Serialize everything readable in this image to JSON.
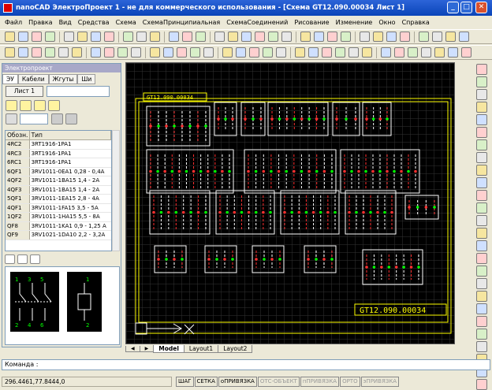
{
  "window": {
    "title": "nanoCAD ЭлектроПроект 1 - не для коммерческого использования - [Схема GT12.090.00034 Лист 1]"
  },
  "menu": [
    "Файл",
    "Правка",
    "Вид",
    "Средства",
    "Схема",
    "СхемаПринципиальная",
    "СхемаСоединений",
    "Рисование",
    "Изменение",
    "Окно",
    "Справка"
  ],
  "panel": {
    "title": "Электропроект",
    "tabs": [
      "ЭУ",
      "Кабели",
      "Жгуты",
      "Ши"
    ],
    "sheet_button": "Лист 1",
    "columns": [
      "Обозн.",
      "Тип"
    ],
    "rows": [
      [
        "4RC2",
        "3RT1916-1PA1"
      ],
      [
        "4RC3",
        "3RT1916-1PA1"
      ],
      [
        "6RC1",
        "3RT1916-1PA1"
      ],
      [
        "6QF1",
        "3RV1011-0EA1 0,28 - 0,4A"
      ],
      [
        "4QF2",
        "3RV1011-1BA15 1,4 - 2A"
      ],
      [
        "4QF3",
        "3RV1011-1BA15 1,4 - 2A"
      ],
      [
        "5QF1",
        "3RV1011-1EA15 2,8 - 4A"
      ],
      [
        "4QF1",
        "3RV1011-1FA15 3,5 - 5A"
      ],
      [
        "1QF2",
        "3RV1011-1HA15 5,5 - 8A"
      ],
      [
        "QF8",
        "3RV1011-1KA1 0,9 - 1,25 A"
      ],
      [
        "QF9",
        "3RV1021-1DA10 2,2 - 3,2A"
      ]
    ],
    "preview_labels": [
      "1",
      "3",
      "5",
      "2",
      "4",
      "6",
      "1",
      "2"
    ]
  },
  "drawing": {
    "stamp": "GT12.090.00034",
    "stamp_small": "GT12.090.00034"
  },
  "layouts": [
    "Model",
    "Layout1",
    "Layout2"
  ],
  "command": {
    "prompt": "Команда :"
  },
  "status": {
    "coords": "296.4461,77.8444,0",
    "buttons": [
      "ШАГ",
      "СЕТКА",
      "оПРИВЯЗКА",
      "ОТС-ОБЪЕКТ",
      "пПРИВЯЗКА",
      "ОРТО",
      "эПРИВЯЗКА"
    ],
    "off": [
      false,
      false,
      false,
      true,
      true,
      true,
      true
    ]
  },
  "colors": {
    "accent": "#ffff00",
    "wire": "#ffffff",
    "pins": "#ff3030",
    "grid": "#3a3a3a"
  }
}
